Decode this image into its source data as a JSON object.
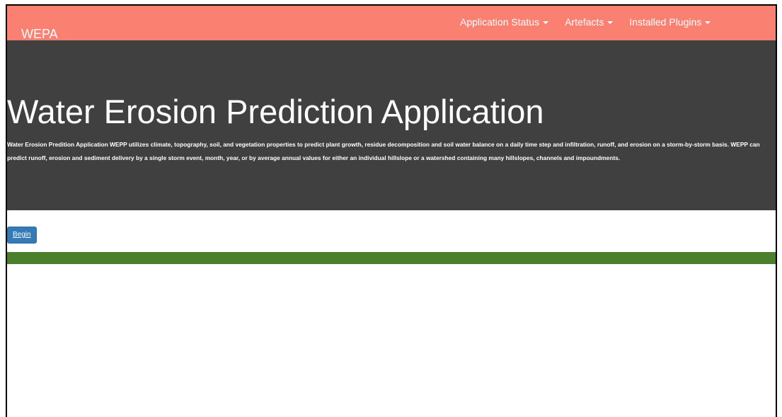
{
  "navbar": {
    "brand": "WEPA",
    "items": [
      {
        "label": "Application Status"
      },
      {
        "label": "Artefacts"
      },
      {
        "label": "Installed Plugins"
      }
    ]
  },
  "jumbotron": {
    "title": "Water Erosion Prediction Application",
    "description": "Water Erosion Predition Application WEPP utilizes climate, topography, soil, and vegetation properties to predict plant growth, residue decomposition and soil water balance on a daily time step and infiltration, runoff, and erosion on a storm-by-storm basis. WEPP can predict runoff, erosion and sediment delivery by a single storm event, month, year, or by average annual values for either an individual hillslope or a watershed containing many hillslopes, channels and impoundments."
  },
  "actions": {
    "begin_label": "Begin"
  },
  "colors": {
    "navbar": "#fa8072",
    "jumbotron": "#404040",
    "button": "#337ab7",
    "band": "#4b7f2b"
  }
}
